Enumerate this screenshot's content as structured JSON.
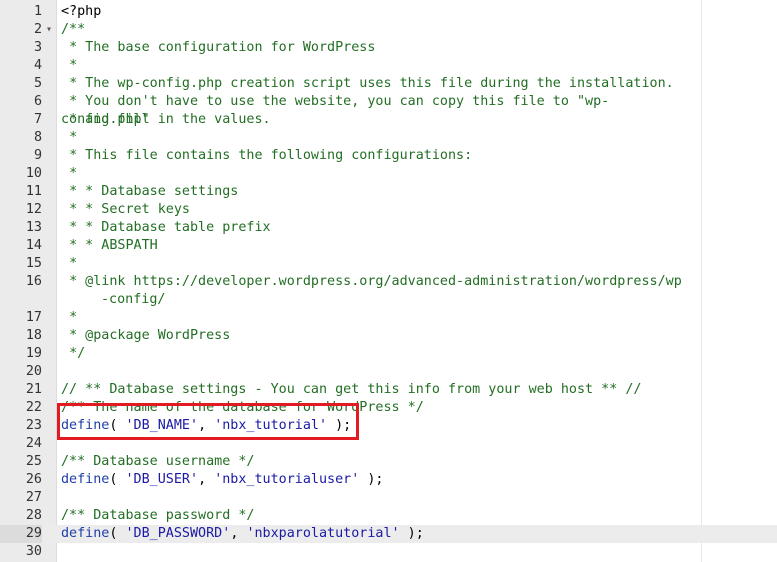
{
  "editor": {
    "fold_marker": "▾",
    "lines": [
      {
        "number": "1",
        "segments": [
          {
            "cls": "c-plain",
            "text": "<?php"
          }
        ]
      },
      {
        "number": "2",
        "fold": true,
        "segments": [
          {
            "cls": "c-comment",
            "text": "/**"
          }
        ]
      },
      {
        "number": "3",
        "segments": [
          {
            "cls": "c-comment",
            "text": " * The base configuration for WordPress"
          }
        ]
      },
      {
        "number": "4",
        "segments": [
          {
            "cls": "c-comment",
            "text": " *"
          }
        ]
      },
      {
        "number": "5",
        "segments": [
          {
            "cls": "c-comment",
            "text": " * The wp-config.php creation script uses this file during the installation."
          }
        ]
      },
      {
        "number": "6",
        "segments": [
          {
            "cls": "c-comment",
            "text": " * You don't have to use the website, you can copy this file to \"wp-config.php\""
          }
        ]
      },
      {
        "number": "7",
        "segments": [
          {
            "cls": "c-comment",
            "text": " * and fill in the values."
          }
        ]
      },
      {
        "number": "8",
        "segments": [
          {
            "cls": "c-comment",
            "text": " *"
          }
        ]
      },
      {
        "number": "9",
        "segments": [
          {
            "cls": "c-comment",
            "text": " * This file contains the following configurations:"
          }
        ]
      },
      {
        "number": "10",
        "segments": [
          {
            "cls": "c-comment",
            "text": " *"
          }
        ]
      },
      {
        "number": "11",
        "segments": [
          {
            "cls": "c-comment",
            "text": " * * Database settings"
          }
        ]
      },
      {
        "number": "12",
        "segments": [
          {
            "cls": "c-comment",
            "text": " * * Secret keys"
          }
        ]
      },
      {
        "number": "13",
        "segments": [
          {
            "cls": "c-comment",
            "text": " * * Database table prefix"
          }
        ]
      },
      {
        "number": "14",
        "segments": [
          {
            "cls": "c-comment",
            "text": " * * ABSPATH"
          }
        ]
      },
      {
        "number": "15",
        "segments": [
          {
            "cls": "c-comment",
            "text": " *"
          }
        ]
      },
      {
        "number": "16",
        "wrapped": true,
        "segments": [
          {
            "cls": "c-comment",
            "text": " * @link https://developer.wordpress.org/advanced-administration/wordpress/wp"
          }
        ],
        "continuation": "-config/"
      },
      {
        "number": "17",
        "segments": [
          {
            "cls": "c-comment",
            "text": " *"
          }
        ]
      },
      {
        "number": "18",
        "segments": [
          {
            "cls": "c-comment",
            "text": " * @package WordPress"
          }
        ]
      },
      {
        "number": "19",
        "segments": [
          {
            "cls": "c-comment",
            "text": " */"
          }
        ]
      },
      {
        "number": "20",
        "segments": []
      },
      {
        "number": "21",
        "segments": [
          {
            "cls": "c-comment",
            "text": "// ** Database settings - You can get this info from your web host ** //"
          }
        ]
      },
      {
        "number": "22",
        "segments": [
          {
            "cls": "c-comment",
            "text": "/** The name of the database for WordPress */"
          }
        ]
      },
      {
        "number": "23",
        "segments": [
          {
            "cls": "c-kw",
            "text": "define"
          },
          {
            "cls": "c-plain",
            "text": "( "
          },
          {
            "cls": "c-str",
            "text": "'DB_NAME'"
          },
          {
            "cls": "c-plain",
            "text": ", "
          },
          {
            "cls": "c-str",
            "text": "'nbx_tutorial'"
          },
          {
            "cls": "c-plain",
            "text": " );"
          }
        ]
      },
      {
        "number": "24",
        "segments": []
      },
      {
        "number": "25",
        "segments": [
          {
            "cls": "c-comment",
            "text": "/** Database username */"
          }
        ]
      },
      {
        "number": "26",
        "segments": [
          {
            "cls": "c-kw",
            "text": "define"
          },
          {
            "cls": "c-plain",
            "text": "( "
          },
          {
            "cls": "c-str",
            "text": "'DB_USER'"
          },
          {
            "cls": "c-plain",
            "text": ", "
          },
          {
            "cls": "c-str",
            "text": "'nbx_tutorialuser'"
          },
          {
            "cls": "c-plain",
            "text": " );"
          }
        ]
      },
      {
        "number": "27",
        "segments": []
      },
      {
        "number": "28",
        "segments": [
          {
            "cls": "c-comment",
            "text": "/** Database password */"
          }
        ]
      },
      {
        "number": "29",
        "active": true,
        "segments": [
          {
            "cls": "c-kw",
            "text": "define"
          },
          {
            "cls": "c-plain",
            "text": "( "
          },
          {
            "cls": "c-str",
            "text": "'DB_PASSWORD'"
          },
          {
            "cls": "c-plain",
            "text": ", "
          },
          {
            "cls": "c-str",
            "text": "'nbxparolatutorial'"
          },
          {
            "cls": "c-plain",
            "text": " );"
          }
        ]
      },
      {
        "number": "30",
        "segments": []
      }
    ]
  },
  "colors": {
    "comment": "#236e24",
    "keyword": "#1f3ea8",
    "string": "#1a1aa6",
    "highlight_box": "#e21b23",
    "gutter": "#ebebeb",
    "active_line": "#ececec"
  }
}
